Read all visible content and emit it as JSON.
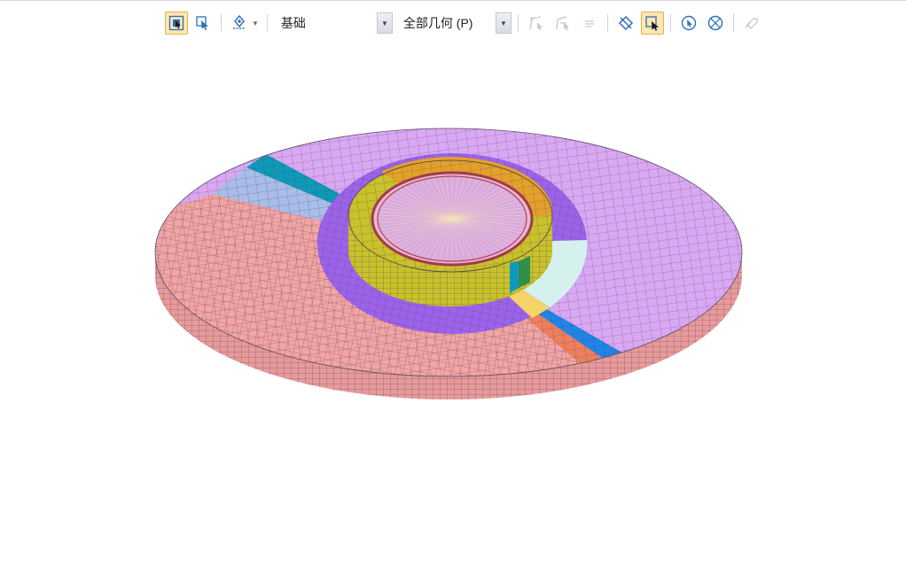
{
  "toolbar": {
    "combo_basic": {
      "value": "基础"
    },
    "combo_geometry": {
      "value": "全部几何 (P)"
    },
    "buttons": [
      {
        "name": "select-elements-button",
        "active": true
      },
      {
        "name": "select-cursor-button",
        "active": false
      },
      {
        "name": "snap-point-button",
        "active": false
      },
      {
        "name": "node-tool-1-button",
        "active": false
      },
      {
        "name": "node-tool-2-button",
        "active": false
      },
      {
        "name": "list-tool-button",
        "active": false
      },
      {
        "name": "deselect-button",
        "active": false
      },
      {
        "name": "box-select-button",
        "active": true
      },
      {
        "name": "pick-point-button",
        "active": false
      },
      {
        "name": "pick-exclude-button",
        "active": false
      },
      {
        "name": "transfer-button",
        "active": false
      }
    ]
  },
  "model": {
    "colors": {
      "pink_region": "#f4a5a5",
      "violet_region": "#d9a8f3",
      "yellow_ring": "#c9c22a",
      "orange_ring": "#e3a12a",
      "purple_annulus": "#9c63ea",
      "blue_band": "#1f85e6",
      "salmon_band": "#ee7f5c",
      "teal_band": "#0f99b8",
      "lightblue_band": "#a8bde8",
      "mint_region": "#d5f1ee",
      "mesh_line": "#4a3d52"
    }
  }
}
